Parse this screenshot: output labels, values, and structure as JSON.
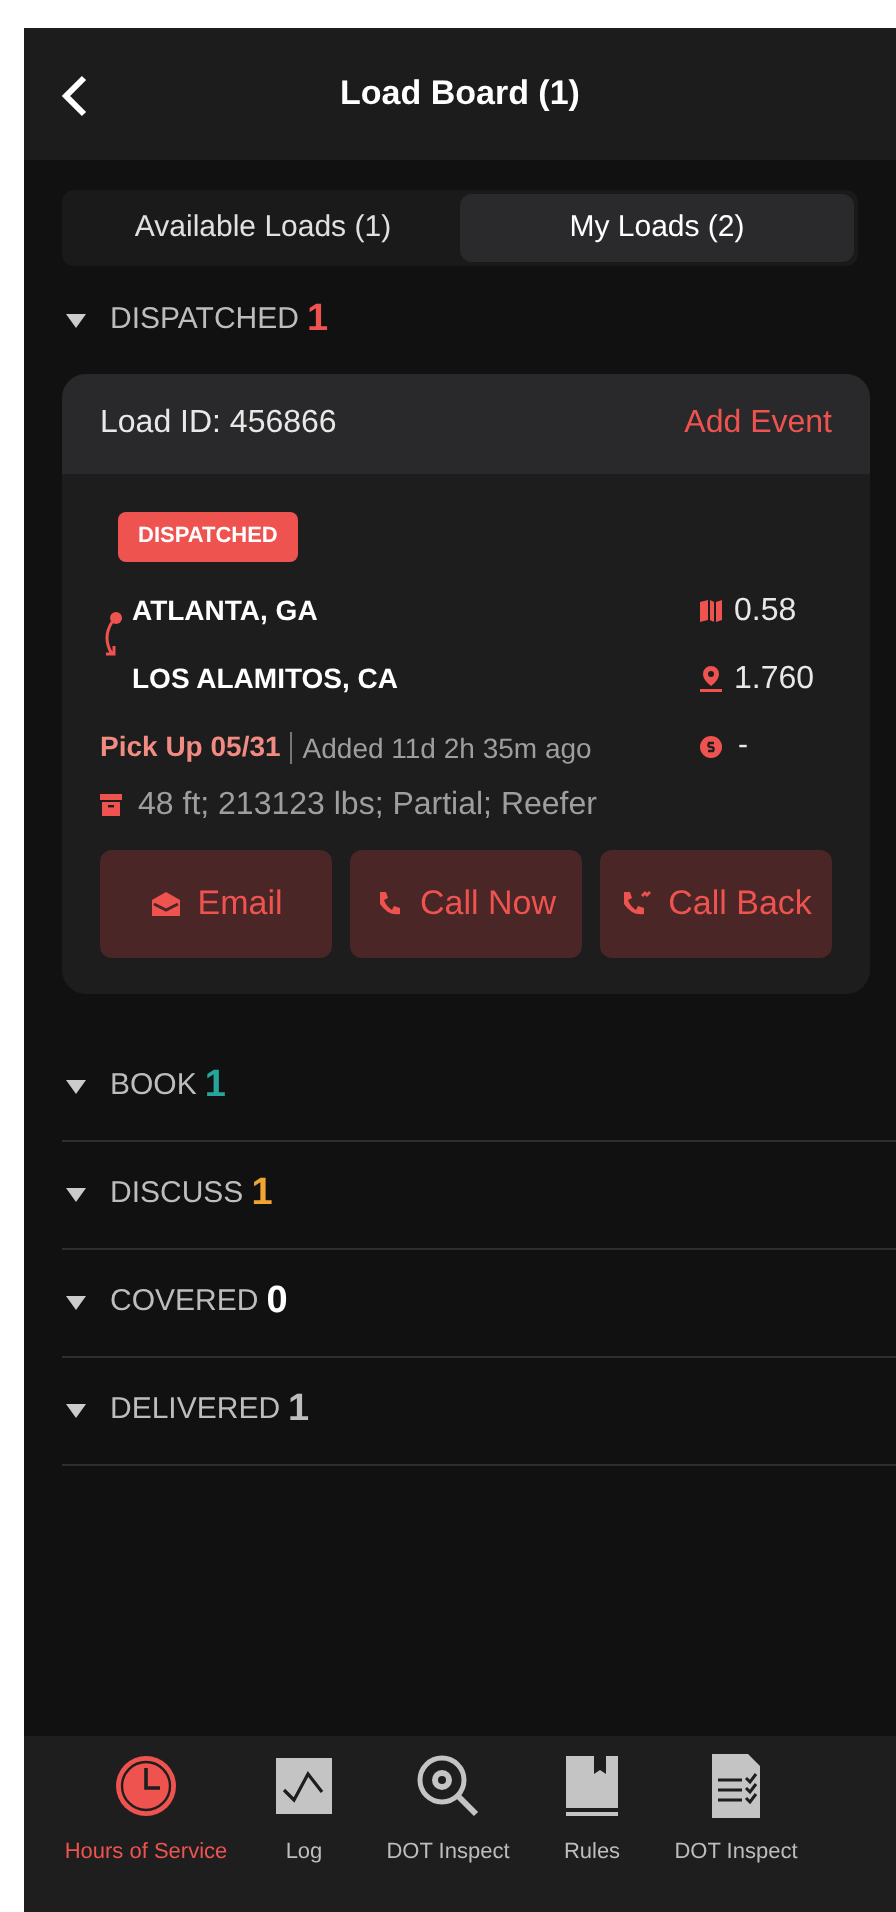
{
  "header": {
    "title": "Load Board (1)"
  },
  "tabs": [
    {
      "label": "Available Loads (1)",
      "selected": false
    },
    {
      "label": "My Loads (2)",
      "selected": true
    }
  ],
  "sections": [
    {
      "name": "DISPATCHED",
      "count": "1",
      "color": "#ef5350",
      "expanded": true,
      "loads": [
        {
          "load_id": "Load ID: 456866",
          "action": "Add Event",
          "status": "DISPATCHED",
          "origin": "ATLANTA, GA",
          "destination": "LOS ALAMITOS, CA",
          "metric_1": "0.58",
          "metric_2": "1.760",
          "pickup": "Pick Up 05/31",
          "added": "Added 11d 2h 35m ago",
          "rate": "-",
          "details": "48 ft; 213123 lbs; Partial; Reefer",
          "buttons": [
            {
              "kind": "email",
              "label": "Email"
            },
            {
              "kind": "call",
              "label": "Call Now"
            },
            {
              "kind": "callback",
              "label": "Call Back"
            }
          ]
        }
      ]
    },
    {
      "name": "BOOK",
      "count": "1",
      "color": "#26a69a",
      "expanded": false
    },
    {
      "name": "DISCUSS",
      "count": "1",
      "color": "#f0a431",
      "expanded": false
    },
    {
      "name": "COVERED",
      "count": "0",
      "color": "#ffffff",
      "expanded": false
    },
    {
      "name": "DELIVERED",
      "count": "1",
      "color": "#bdbdbd",
      "expanded": false
    }
  ],
  "bottom_nav": [
    {
      "kind": "clock",
      "label": "Hours of Service",
      "selected": true
    },
    {
      "kind": "log",
      "label": "Log",
      "selected": false
    },
    {
      "kind": "inspect",
      "label": "DOT Inspect",
      "selected": false
    },
    {
      "kind": "book",
      "label": "Rules",
      "selected": false
    },
    {
      "kind": "doc",
      "label": "DOT Inspect",
      "selected": false
    }
  ]
}
